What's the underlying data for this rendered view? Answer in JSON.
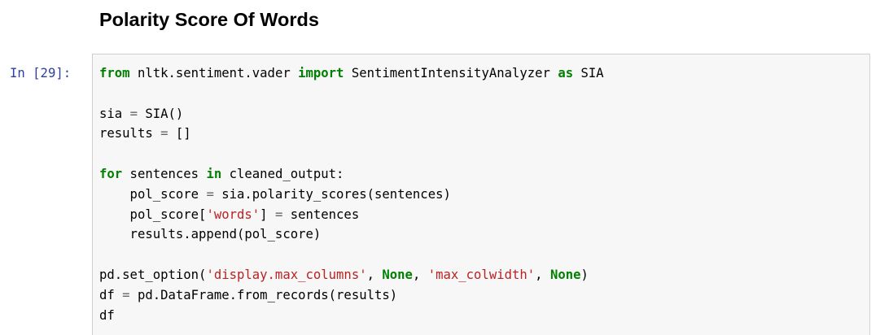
{
  "heading": "Polarity Score Of Words",
  "cell": {
    "prompt": "In [29]:",
    "lines": [
      [
        {
          "t": "from",
          "c": "kw"
        },
        {
          "t": " nltk.sentiment.vader ",
          "c": ""
        },
        {
          "t": "import",
          "c": "kw"
        },
        {
          "t": " SentimentIntensityAnalyzer ",
          "c": ""
        },
        {
          "t": "as",
          "c": "kw"
        },
        {
          "t": " SIA",
          "c": ""
        }
      ],
      [],
      [
        {
          "t": "sia ",
          "c": ""
        },
        {
          "t": "=",
          "c": "op"
        },
        {
          "t": " SIA()",
          "c": ""
        }
      ],
      [
        {
          "t": "results ",
          "c": ""
        },
        {
          "t": "=",
          "c": "op"
        },
        {
          "t": " []",
          "c": ""
        }
      ],
      [],
      [
        {
          "t": "for",
          "c": "kw"
        },
        {
          "t": " sentences ",
          "c": ""
        },
        {
          "t": "in",
          "c": "kw"
        },
        {
          "t": " cleaned_output:",
          "c": ""
        }
      ],
      [
        {
          "t": "    pol_score ",
          "c": ""
        },
        {
          "t": "=",
          "c": "op"
        },
        {
          "t": " sia.polarity_scores(sentences)",
          "c": ""
        }
      ],
      [
        {
          "t": "    pol_score[",
          "c": ""
        },
        {
          "t": "'words'",
          "c": "str"
        },
        {
          "t": "] ",
          "c": ""
        },
        {
          "t": "=",
          "c": "op"
        },
        {
          "t": " sentences",
          "c": ""
        }
      ],
      [
        {
          "t": "    results.append(pol_score)",
          "c": ""
        }
      ],
      [],
      [
        {
          "t": "pd.set_option(",
          "c": ""
        },
        {
          "t": "'display.max_columns'",
          "c": "str"
        },
        {
          "t": ", ",
          "c": ""
        },
        {
          "t": "None",
          "c": "kc"
        },
        {
          "t": ", ",
          "c": ""
        },
        {
          "t": "'max_colwidth'",
          "c": "str"
        },
        {
          "t": ", ",
          "c": ""
        },
        {
          "t": "None",
          "c": "kc"
        },
        {
          "t": ")",
          "c": ""
        }
      ],
      [
        {
          "t": "df ",
          "c": ""
        },
        {
          "t": "=",
          "c": "op"
        },
        {
          "t": " pd.DataFrame.from_records(results)",
          "c": ""
        }
      ],
      [
        {
          "t": "df",
          "c": ""
        }
      ]
    ]
  },
  "colors": {
    "keyword": "#008000",
    "operator": "#666666",
    "string": "#ba2121",
    "prompt": "#303f9f",
    "cell_background": "#f7f7f7",
    "cell_border": "#cfcfcf"
  }
}
